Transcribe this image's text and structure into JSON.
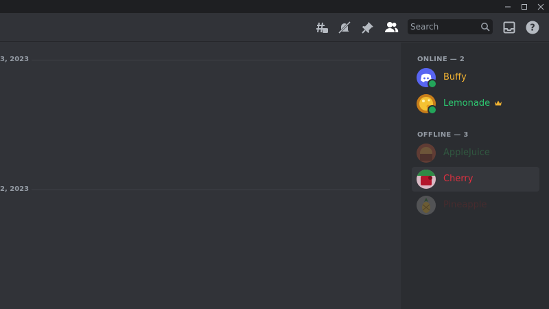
{
  "window": {
    "minimize_icon": "minimize-icon",
    "maximize_icon": "maximize-icon",
    "close_icon": "close-icon"
  },
  "header": {
    "icons": [
      "threads-icon",
      "mute-bell-icon",
      "pin-icon",
      "member-list-icon",
      "inbox-icon",
      "help-icon"
    ],
    "search": {
      "placeholder": "Search"
    }
  },
  "messages": {
    "dividers": [
      {
        "date": "3, 2023"
      },
      {
        "date": "2, 2023"
      }
    ]
  },
  "members": {
    "online_header": "ONLINE — 2",
    "offline_header": "OFFLINE — 3",
    "online": [
      {
        "name": "Buffy",
        "color": "#f0b232"
      },
      {
        "name": "Lemonade",
        "color": "#2dc770",
        "badge": "crown-icon"
      }
    ],
    "offline": [
      {
        "name": "AppleJuice",
        "color": "#3ba55c"
      },
      {
        "name": "Cherry",
        "color": "#e03040"
      },
      {
        "name": "Pineapple",
        "color": "#7a2a2a"
      }
    ]
  },
  "colors": {
    "background": "#313338",
    "sidebar": "#2b2d31",
    "titlebar": "#1e1f22"
  }
}
